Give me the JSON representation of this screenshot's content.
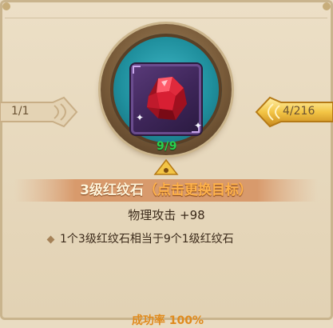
{
  "left_banner": {
    "text": "1/1"
  },
  "right_banner": {
    "text": "4/216"
  },
  "slot": {
    "count": "9/9",
    "icon": "red-gem-icon"
  },
  "item": {
    "name": "3级红纹石",
    "action": "（点击更换目标）"
  },
  "stat": {
    "text": "物理攻击 +98"
  },
  "note": {
    "text": "1个3级红纹石相当于9个1级红纹石"
  },
  "success_rate": {
    "text": "成功率 100%"
  },
  "colors": {
    "count_green": "#29d24e",
    "action_orange": "#ffb24a",
    "medallion_teal": "#1f8f9d",
    "slot_purple": "#3d2558"
  }
}
